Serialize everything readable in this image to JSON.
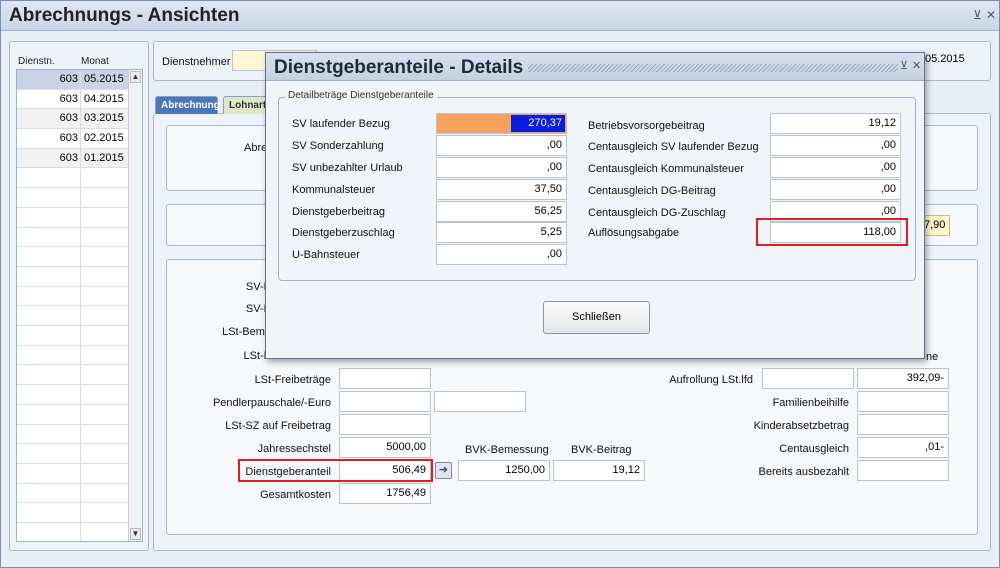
{
  "window": {
    "title": "Abrechnungs - Ansichten",
    "controls": [
      "⊻",
      "✕"
    ]
  },
  "list": {
    "headers": [
      "Dienstn.",
      "Monat"
    ],
    "rows": [
      {
        "id": "603",
        "month": "05.2015"
      },
      {
        "id": "603",
        "month": "04.2015"
      },
      {
        "id": "603",
        "month": "03.2015"
      },
      {
        "id": "603",
        "month": "02.2015"
      },
      {
        "id": "603",
        "month": "01.2015"
      }
    ]
  },
  "header": {
    "dienstnehmer_label": "Dienstnehmer",
    "period_value": "05.2015"
  },
  "tabs": [
    "Abrechnung",
    "Lohnart"
  ],
  "background": {
    "abre_label": "Abre",
    "partial_value": "7,90",
    "partial_labels": [
      "SV-E",
      "SV-E",
      "LSt-Beme",
      "LSt-E"
    ],
    "partial_right_label": "ne",
    "left_fields": [
      {
        "label": "LSt-Freibeträge",
        "value": ""
      },
      {
        "label": "Pendlerpauschale/-Euro",
        "value": ""
      },
      {
        "label": "LSt-SZ auf Freibetrag",
        "value": ""
      },
      {
        "label": "Jahressechstel",
        "value": "5000,00"
      },
      {
        "label": "Dienstgeberanteil",
        "value": "506,49"
      },
      {
        "label": "Gesamtkosten",
        "value": "1756,49"
      }
    ],
    "bvk": {
      "bemessung_label": "BVK-Bemessung",
      "bemessung_value": "1250,00",
      "beitrag_label": "BVK-Beitrag",
      "beitrag_value": "19,12"
    },
    "right_fields": [
      {
        "label": "Aufrollung LSt.lfd",
        "value": "",
        "value2": "392,09-"
      },
      {
        "label": "Familienbeihilfe",
        "value": ""
      },
      {
        "label": "Kinderabsetzbetrag",
        "value": ""
      },
      {
        "label": "Centausgleich",
        "value": ",01-"
      },
      {
        "label": "Bereits ausbezahlt",
        "value": ""
      }
    ]
  },
  "modal": {
    "title": "Dienstgeberanteile - Details",
    "controls": [
      "⊻",
      "✕"
    ],
    "group_title": "Detailbeträge Dienstgeberanteile",
    "left": [
      {
        "label": "SV laufender Bezug",
        "value": "270,37"
      },
      {
        "label": "SV Sonderzahlung",
        "value": ",00"
      },
      {
        "label": "SV unbezahlter Urlaub",
        "value": ",00"
      },
      {
        "label": "Kommunalsteuer",
        "value": "37,50"
      },
      {
        "label": "Dienstgeberbeitrag",
        "value": "56,25"
      },
      {
        "label": "Dienstgeberzuschlag",
        "value": "5,25"
      },
      {
        "label": "U-Bahnsteuer",
        "value": ",00"
      }
    ],
    "right": [
      {
        "label": "Betriebsvorsorgebeitrag",
        "value": "19,12"
      },
      {
        "label": "Centausgleich SV laufender Bezug",
        "value": ",00"
      },
      {
        "label": "Centausgleich Kommunalsteuer",
        "value": ",00"
      },
      {
        "label": "Centausgleich DG-Beitrag",
        "value": ",00"
      },
      {
        "label": "Centausgleich DG-Zuschlag",
        "value": ",00"
      },
      {
        "label": "Auflösungsabgabe",
        "value": "118,00"
      }
    ],
    "close_button": "Schließen"
  },
  "colors": {
    "highlight": "#e21b1b",
    "selected_field": "#0a1ee0",
    "field_accent": "#f5a25c"
  }
}
